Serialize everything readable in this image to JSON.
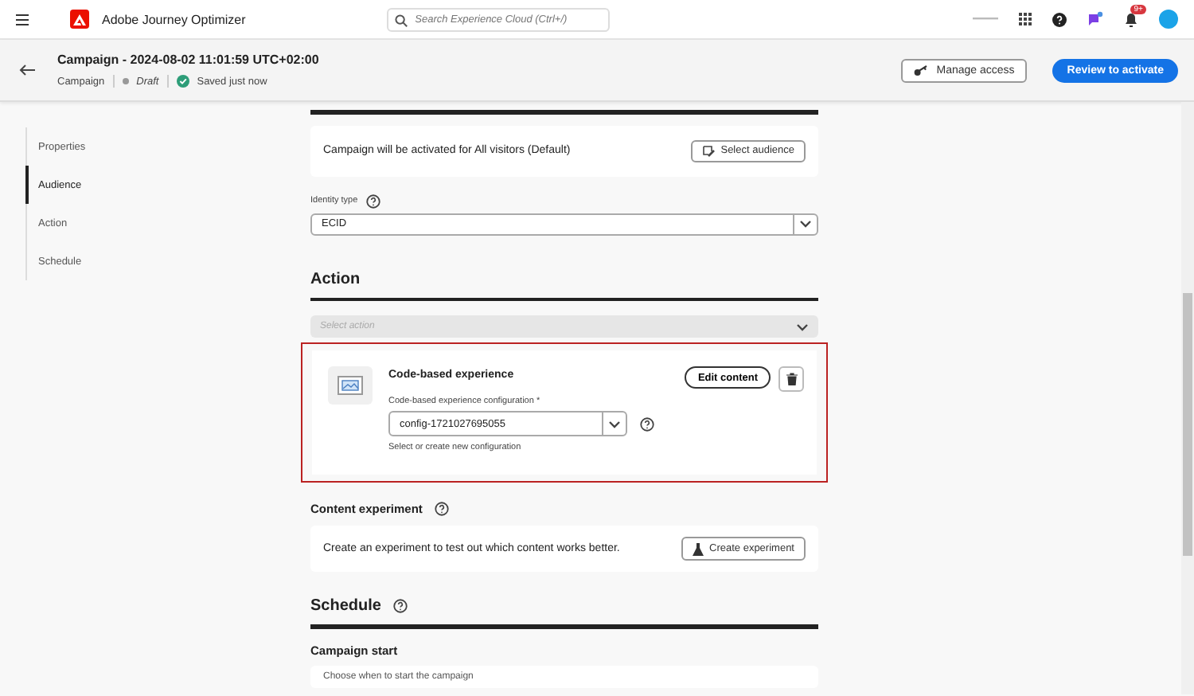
{
  "topbar": {
    "app_name": "Adobe Journey Optimizer",
    "search": {
      "placeholder": "Search Experience Cloud (Ctrl+/)"
    },
    "notification_badge": "9+"
  },
  "header": {
    "title": "Campaign - 2024-08-02 11:01:59 UTC+02:00",
    "type": "Campaign",
    "status": "Draft",
    "save_state": "Saved just now",
    "buttons": [
      {
        "kind": "secondary",
        "label": "Manage access"
      },
      {
        "kind": "primary",
        "label": "Review to activate"
      }
    ]
  },
  "sidebar": {
    "items": [
      {
        "label": "Properties",
        "selected": false
      },
      {
        "label": "Audience",
        "selected": true
      },
      {
        "label": "Action",
        "selected": false
      },
      {
        "label": "Schedule",
        "selected": false
      }
    ]
  },
  "audience": {
    "description": "Campaign will be activated for All visitors (Default)",
    "button": "Select audience",
    "identity_label": "Identity type",
    "identity_value": "ECID"
  },
  "action": {
    "heading": "Action",
    "select_placeholder": "Select action",
    "card": {
      "title": "Code-based experience",
      "config_label": "Code-based experience configuration",
      "required_mark": "*",
      "config_value": "config-1721027695055",
      "hint": "Select or create new configuration",
      "edit_button": "Edit content"
    }
  },
  "experiment": {
    "heading": "Content experiment",
    "description": "Create an experiment to test out which content works better.",
    "button": "Create experiment"
  },
  "schedule": {
    "heading": "Schedule",
    "subheading": "Campaign start",
    "description": "Choose when to start the campaign"
  }
}
